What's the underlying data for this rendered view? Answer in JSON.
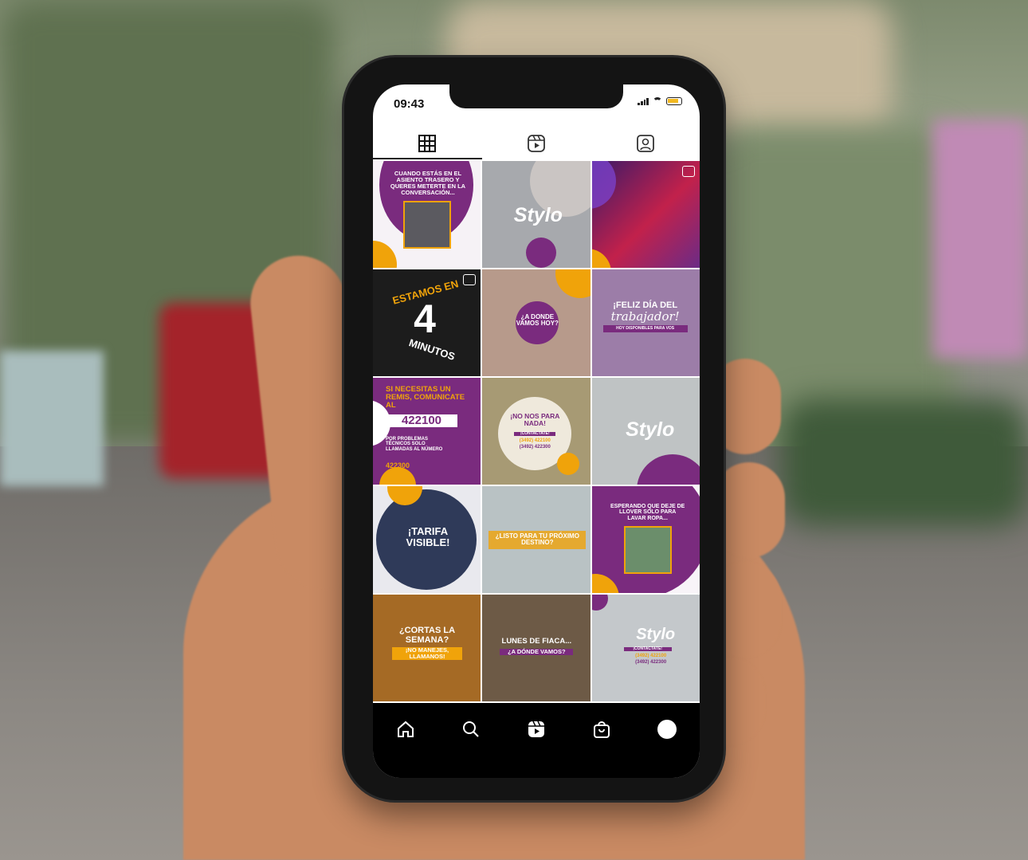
{
  "status": {
    "time": "09:43"
  },
  "profile_tabs": [
    {
      "name": "grid",
      "icon": "grid-icon",
      "active": true
    },
    {
      "name": "reels",
      "icon": "reels-icon",
      "active": false
    },
    {
      "name": "tagged",
      "icon": "tagged-person-icon",
      "active": false
    }
  ],
  "posts": {
    "p1": {
      "text": "CUANDO ESTÁS EN EL ASIENTO TRASERO Y QUERES METERTE EN LA CONVERSACIÓN..."
    },
    "p2": {
      "brand": "Stylo"
    },
    "p4": {
      "line1": "ESTAMOS EN",
      "number": "4",
      "line2": "MINUTOS"
    },
    "p5": {
      "text": "¿A DONDE VAMOS HOY?"
    },
    "p6": {
      "title": "¡FELIZ DÍA DEL",
      "script": "trabajador!",
      "sub": "HOY DISPONIBLES PARA VOS"
    },
    "p7": {
      "headline": "SI NECESITAS UN REMIS, COMUNICATE AL",
      "phone": "422100",
      "note": "POR PROBLEMAS TÉCNICOS SOLO LLAMADAS AL NÚMERO",
      "phone2": "422300"
    },
    "p8": {
      "text": "¡NO NOS PARA NADA!",
      "contact": "¡CONTACTATE!",
      "phone_a": "(3492) 422100",
      "phone_b": "(3492) 422300"
    },
    "p9": {
      "brand": "Stylo"
    },
    "p10": {
      "text": "¡TARIFA VISIBLE!"
    },
    "p11": {
      "text": "¿LISTO PARA TU PRÓXIMO DESTINO?"
    },
    "p12": {
      "text": "ESPERANDO QUE DEJE DE LLOVER SOLO PARA LAVAR ROPA..."
    },
    "p13": {
      "text": "¿CORTAS LA SEMANA?",
      "sub": "¡NO MANEJES, LLAMANOS!"
    },
    "p14": {
      "text": "LUNES DE FIACA...",
      "sub": "¿A DÓNDE VAMOS?"
    },
    "p15": {
      "brand": "Stylo",
      "contact": "¡CONTACTATE!",
      "phone_a": "(3492) 422100",
      "phone_b": "(3492) 422300"
    }
  },
  "bottom_nav": [
    {
      "name": "home",
      "icon": "home-icon"
    },
    {
      "name": "search",
      "icon": "search-icon"
    },
    {
      "name": "reels",
      "icon": "reels-icon"
    },
    {
      "name": "shop",
      "icon": "shopping-bag-icon"
    },
    {
      "name": "profile",
      "icon": "profile-avatar-icon"
    }
  ],
  "colors": {
    "brand_purple": "#7a2b7e",
    "brand_orange": "#f0a30a"
  }
}
